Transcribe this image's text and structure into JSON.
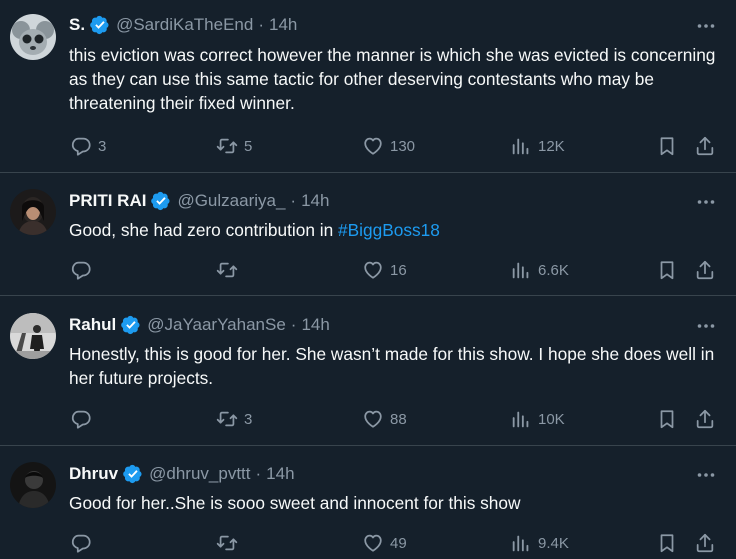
{
  "colors": {
    "background": "#15202b",
    "text": "#f7f9f9",
    "secondary": "#8b98a5",
    "accent": "#1d9bf0",
    "divider": "#38444d"
  },
  "tweets": [
    {
      "name": "S.",
      "handle": "@SardiKaTheEnd",
      "dot": "·",
      "time": "14h",
      "text": "this eviction was correct however the manner is which she was evicted is concerning as they can use this same tactic for other deserving contestants who may be threatening their fixed winner.",
      "replies": "3",
      "retweets": "5",
      "likes": "130",
      "views": "12K"
    },
    {
      "name": "PRITI RAI",
      "handle": "@Gulzaariya_",
      "dot": "·",
      "time": "14h",
      "text": "Good, she had zero contribution in ",
      "hashtag": "#BiggBoss18",
      "replies": "",
      "retweets": "",
      "likes": "16",
      "views": "6.6K"
    },
    {
      "name": "Rahul",
      "handle": "@JaYaarYahanSe",
      "dot": "·",
      "time": "14h",
      "text": "Honestly, this is good for her. She wasn’t made for this show. I hope she does well in her future projects.",
      "replies": "",
      "retweets": "3",
      "likes": "88",
      "views": "10K"
    },
    {
      "name": "Dhruv",
      "handle": "@dhruv_pvttt",
      "dot": "·",
      "time": "14h",
      "text": "Good for her..She is sooo sweet and innocent for this show",
      "replies": "",
      "retweets": "",
      "likes": "49",
      "views": "9.4K"
    }
  ]
}
